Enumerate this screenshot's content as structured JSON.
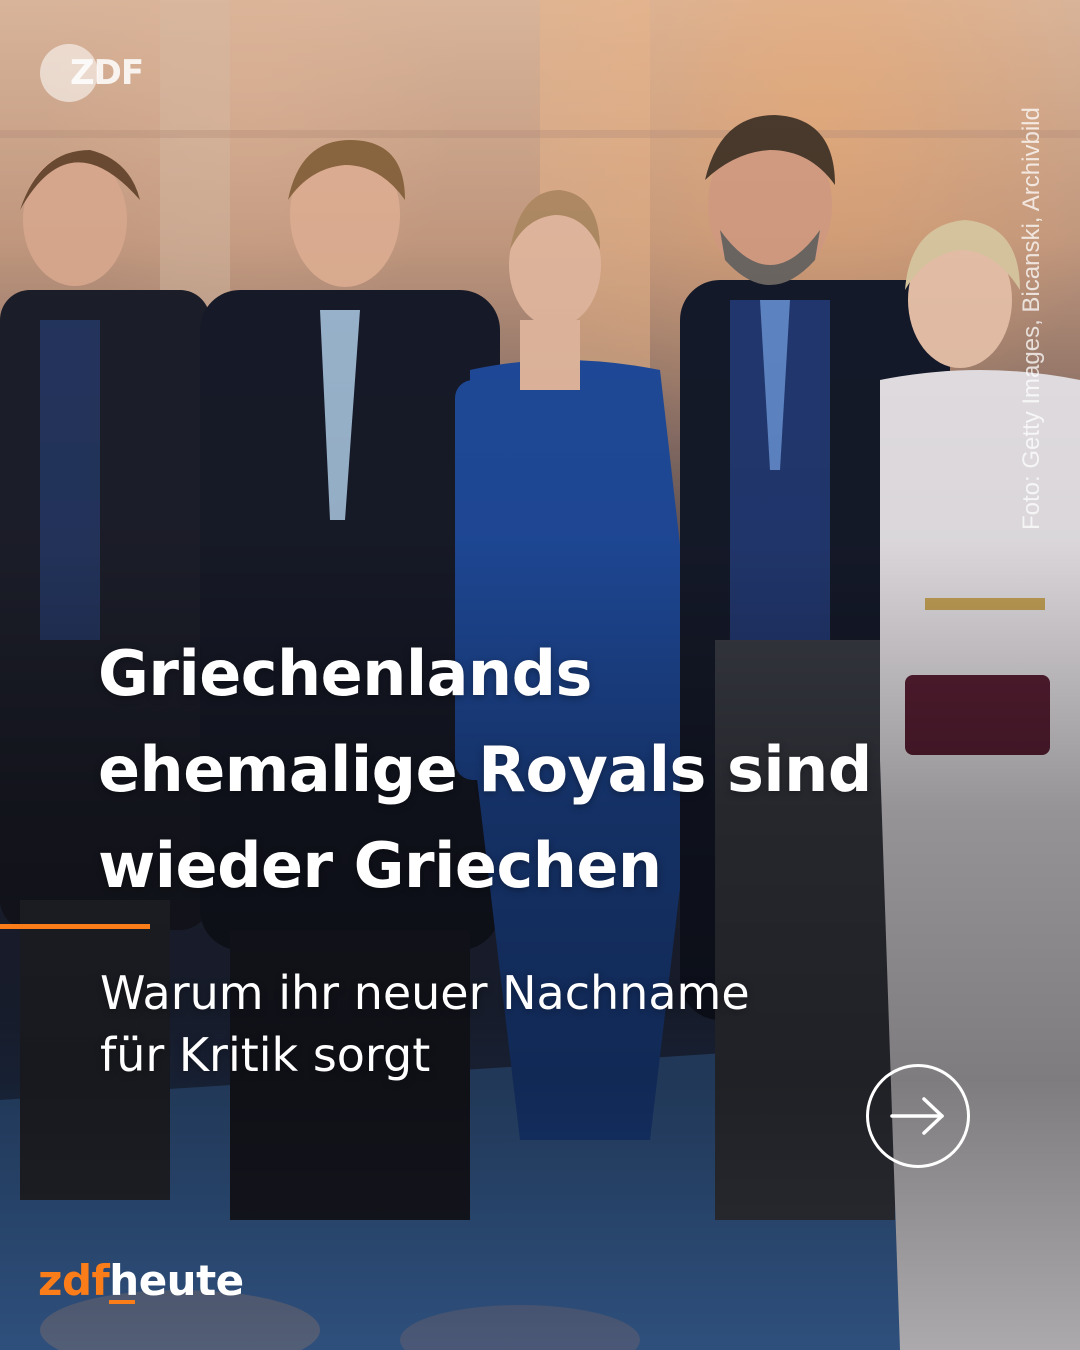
{
  "watermark": {
    "logo_text": "ZDF"
  },
  "photo": {
    "credit": "Foto: Getty Images, Bicanski, Archivbild"
  },
  "headline": {
    "line1": "Griechenlands",
    "line2": "ehemalige Royals sind",
    "line3": "wieder Griechen"
  },
  "subline": {
    "line1": "Warum ihr neuer Nachname",
    "line2": "für Kritik sorgt"
  },
  "brand": {
    "part1": "zdf",
    "part2": "heute"
  },
  "colors": {
    "accent": "#fa7d19",
    "text": "#ffffff"
  },
  "icons": {
    "next": "arrow-right-circle-icon"
  }
}
